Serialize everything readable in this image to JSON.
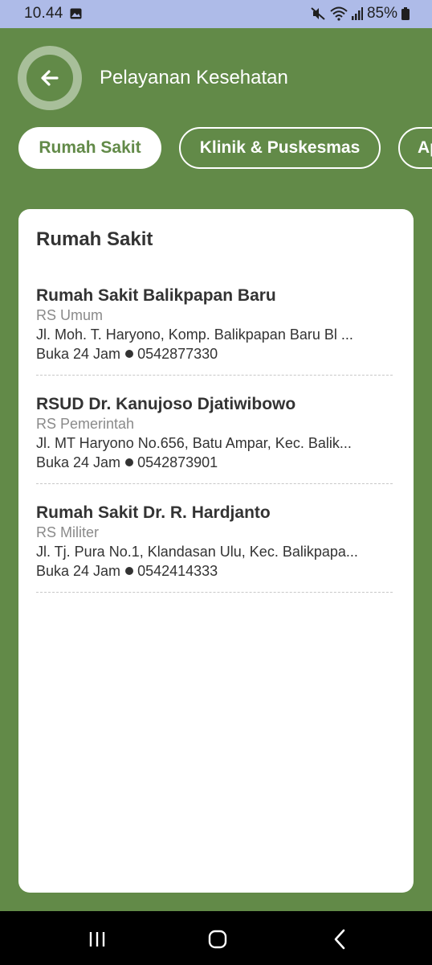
{
  "status_bar": {
    "time": "10.44",
    "battery": "85%"
  },
  "header": {
    "title": "Pelayanan Kesehatan"
  },
  "tabs": [
    {
      "label": "Rumah Sakit",
      "active": true
    },
    {
      "label": "Klinik & Puskesmas",
      "active": false
    },
    {
      "label": "Ap",
      "active": false
    }
  ],
  "section": {
    "title": "Rumah Sakit",
    "hospitals": [
      {
        "name": "Rumah Sakit Balikpapan Baru",
        "type": "RS Umum",
        "address": "Jl. Moh. T. Haryono, Komp. Balikpapan Baru Bl ...",
        "hours": "Buka 24 Jam",
        "phone": "0542877330"
      },
      {
        "name": "RSUD Dr. Kanujoso Djatiwibowo",
        "type": "RS Pemerintah",
        "address": "Jl. MT Haryono No.656, Batu Ampar, Kec. Balik...",
        "hours": "Buka 24 Jam",
        "phone": "0542873901"
      },
      {
        "name": "Rumah Sakit Dr. R. Hardjanto",
        "type": "RS Militer",
        "address": "Jl. Tj. Pura No.1, Klandasan Ulu, Kec. Balikpapa...",
        "hours": "Buka 24 Jam",
        "phone": "0542414333"
      }
    ]
  },
  "icons": {
    "back": "arrow-left-icon",
    "status_image": "image-icon",
    "mute": "mute-icon",
    "wifi": "wifi-icon",
    "signal": "signal-icon",
    "battery": "battery-icon",
    "nav_recents": "recents-icon",
    "nav_home": "home-icon",
    "nav_back": "nav-back-icon"
  },
  "colors": {
    "primary": "#628a48",
    "status_bar": "#aebbe8",
    "card": "#ffffff",
    "text": "#333333",
    "muted": "#8a8a8a"
  }
}
